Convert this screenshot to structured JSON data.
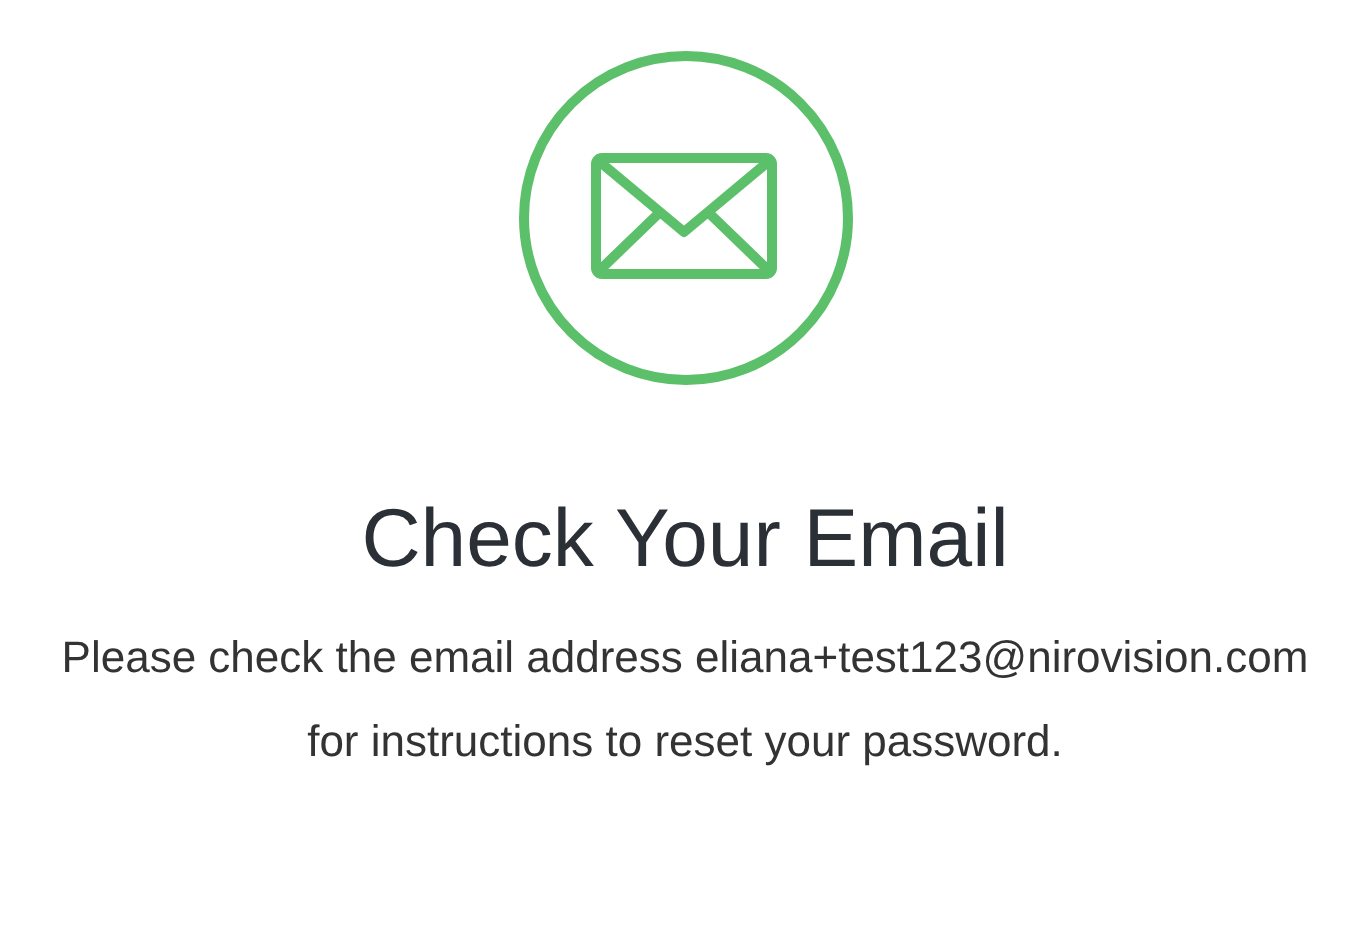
{
  "heading": "Check Your Email",
  "message": "Please check the email address eliana+test123@nirovision.com for instructions to reset your password."
}
